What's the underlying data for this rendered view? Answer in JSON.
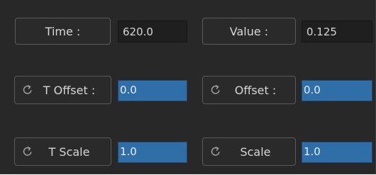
{
  "row1": {
    "time_label": "Time :",
    "time_value": "620.0",
    "value_label": "Value :",
    "value_value": "0.125"
  },
  "row2": {
    "t_offset_label": "T Offset :",
    "t_offset_value": "0.0",
    "offset_label": "Offset :",
    "offset_value": "0.0"
  },
  "row3": {
    "t_scale_label": "T Scale",
    "t_scale_value": "1.0",
    "scale_label": "Scale",
    "scale_value": "1.0"
  },
  "icons": {
    "reset": "reset-icon"
  },
  "colors": {
    "panel_bg": "#282828",
    "field_bg": "#1f1f1f",
    "active_field_bg": "#2f6ea6",
    "text": "#d6d6d6"
  }
}
